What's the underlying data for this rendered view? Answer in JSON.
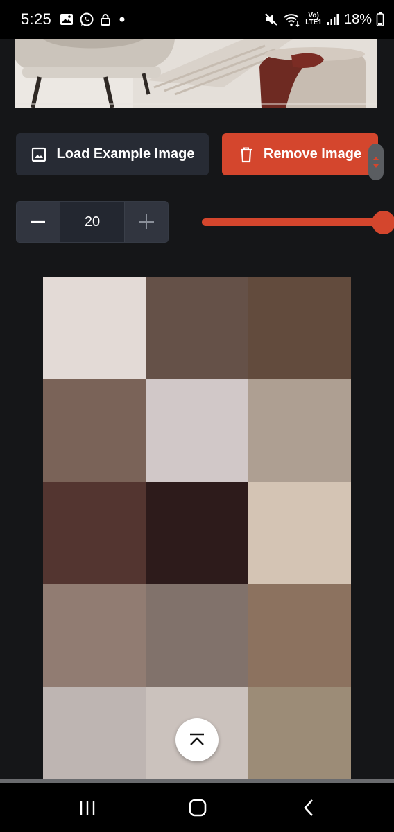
{
  "status_bar": {
    "time": "5:25",
    "left_icons": [
      "gallery-icon",
      "whatsapp-icon",
      "lock-icon",
      "dot-icon"
    ],
    "right_icons": [
      "mute-icon",
      "wifi-icon",
      "volte-icon",
      "signal-icon",
      "battery-icon"
    ],
    "volte_label_top": "Vo)",
    "volte_label_bottom": "LTE1",
    "battery": "18%"
  },
  "actions": {
    "load_label": "Load Example Image",
    "remove_label": "Remove Image"
  },
  "stepper": {
    "value": "20",
    "minus_icon": "minus-icon",
    "plus_icon": "plus-icon"
  },
  "slider": {
    "value_fraction": 1.0
  },
  "colors": {
    "accent": "#d4462d",
    "background": "#151618"
  },
  "palette": [
    "#e3dad6",
    "#655148",
    "#624b3d",
    "#7a6358",
    "#d1c8c8",
    "#ae9f92",
    "#533530",
    "#2d1b1b",
    "#d4c4b4",
    "#917c72",
    "#81726b",
    "#8c725f",
    "#beb5b2",
    "#cbc2bd",
    "#9c8c77"
  ],
  "floating_button": {
    "icon": "scroll-to-top-icon"
  },
  "nav": {
    "recents_icon": "recents-icon",
    "home_icon": "home-icon",
    "back_icon": "back-icon"
  }
}
